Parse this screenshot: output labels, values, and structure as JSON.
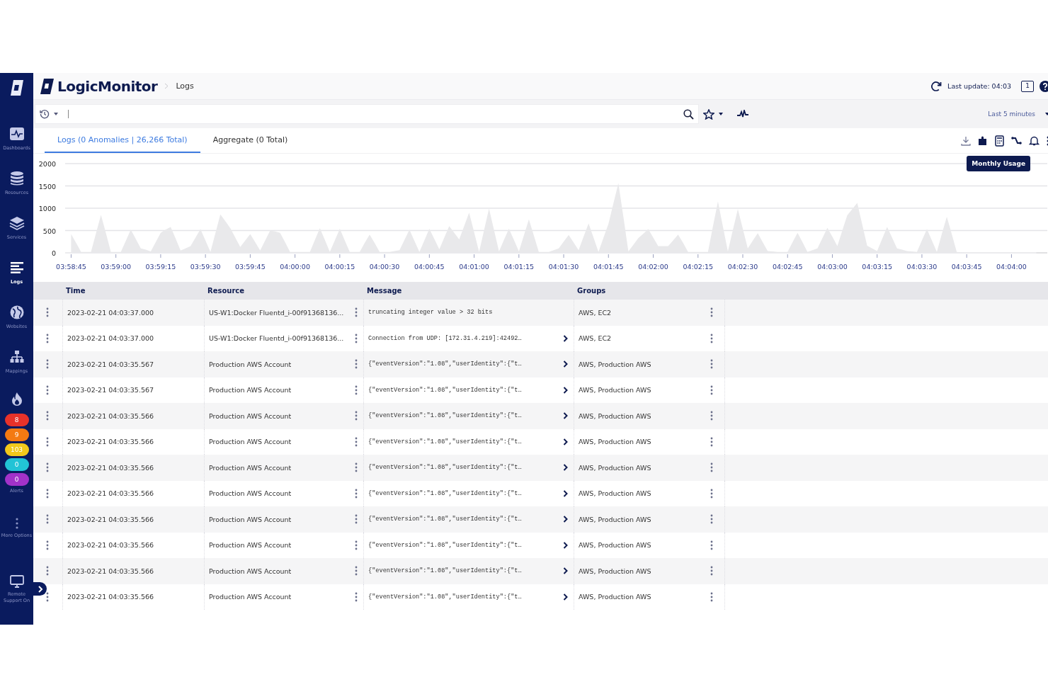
{
  "sidebar": {
    "nav": [
      {
        "label": "Dashboards",
        "selected": false
      },
      {
        "label": "Resources",
        "selected": false
      },
      {
        "label": "Services",
        "selected": false
      },
      {
        "label": "Logs",
        "selected": true
      },
      {
        "label": "Websites",
        "selected": false
      },
      {
        "label": "Mappings",
        "selected": false
      }
    ],
    "alert_badges": [
      {
        "count": "8",
        "color": "#e8322a"
      },
      {
        "count": "9",
        "color": "#f47a12"
      },
      {
        "count": "103",
        "color": "#f2c81b"
      },
      {
        "count": "0",
        "color": "#22c3d6"
      },
      {
        "count": "0",
        "color": "#a232c9"
      }
    ],
    "alerts_label": "Alerts",
    "more_options": "More Options",
    "remote_support": "Remote Support On"
  },
  "header": {
    "brand": "LogicMonitor",
    "breadcrumb": "Logs",
    "last_update": "Last update: 04:03",
    "notifications": "1"
  },
  "search": {
    "time_range": "Last 5 minutes"
  },
  "tabs": [
    {
      "label": "Logs (0 Anomalies | 26,266 Total)",
      "selected": true
    },
    {
      "label": "Aggregate (0 Total)",
      "selected": false
    }
  ],
  "tooltip": "Monthly Usage",
  "chart_data": {
    "type": "area",
    "grid": true,
    "ylim": [
      0,
      2000
    ],
    "yticks": [
      0,
      500,
      1000,
      1500,
      2000
    ],
    "categories": [
      "03:58:45",
      null,
      null,
      null,
      null,
      null,
      null,
      null,
      null,
      "03:59:00",
      null,
      null,
      null,
      null,
      null,
      null,
      null,
      null,
      "03:59:15",
      null,
      null,
      null,
      null,
      null,
      null,
      null,
      null,
      "03:59:30",
      null,
      null,
      null,
      null,
      null,
      null,
      null,
      null,
      "03:59:45",
      null,
      null,
      null,
      null,
      null,
      null,
      null,
      null,
      "04:00:00",
      null,
      null,
      null,
      null,
      null,
      null,
      null,
      null,
      "04:00:15",
      null,
      null,
      null,
      null,
      null,
      null,
      null,
      null,
      "04:00:30",
      null,
      null,
      null,
      null,
      null,
      null,
      null,
      null,
      "04:00:45",
      null,
      null,
      null,
      null,
      null,
      null,
      null,
      null,
      "04:01:00",
      null,
      null,
      null,
      null,
      null,
      null,
      null,
      null,
      "04:01:15",
      null,
      null,
      null,
      null,
      null,
      null,
      null,
      null,
      "04:01:30",
      null,
      null,
      null,
      null,
      null,
      null,
      null,
      null,
      "04:01:45",
      null,
      null,
      null,
      null,
      null,
      null,
      null,
      null,
      "04:02:00",
      null,
      null,
      null,
      null,
      null,
      null,
      null,
      null,
      "04:02:15",
      null,
      null,
      null,
      null,
      null,
      null,
      null,
      null,
      "04:02:30",
      null,
      null,
      null,
      null,
      null,
      null,
      null,
      null,
      "04:02:45",
      null,
      null,
      null,
      null,
      null,
      null,
      null,
      null,
      "04:03:00",
      null,
      null,
      null,
      null,
      null,
      null,
      null,
      null,
      "04:03:15",
      null,
      null,
      null,
      null,
      null,
      null,
      null,
      null,
      "04:03:30",
      null,
      null,
      null,
      null,
      null,
      null,
      null,
      null,
      "04:03:45",
      null,
      null,
      null,
      null,
      null,
      null,
      null,
      null,
      "04:04:00",
      null,
      null,
      null,
      null,
      null
    ],
    "values": [
      420,
      220,
      20,
      20,
      20,
      440,
      850,
      440,
      20,
      20,
      20,
      270,
      520,
      310,
      100,
      70,
      30,
      240,
      450,
      520,
      580,
      320,
      50,
      100,
      150,
      340,
      530,
      280,
      20,
      440,
      860,
      710,
      550,
      340,
      130,
      280,
      420,
      240,
      50,
      280,
      500,
      480,
      450,
      240,
      20,
      20,
      20,
      20,
      20,
      290,
      550,
      290,
      20,
      280,
      540,
      280,
      20,
      20,
      20,
      220,
      410,
      220,
      20,
      20,
      20,
      40,
      60,
      290,
      520,
      270,
      20,
      280,
      540,
      310,
      80,
      340,
      600,
      450,
      300,
      600,
      900,
      460,
      20,
      510,
      990,
      510,
      30,
      290,
      540,
      290,
      30,
      390,
      750,
      390,
      20,
      20,
      20,
      60,
      100,
      250,
      400,
      230,
      60,
      360,
      660,
      340,
      20,
      340,
      650,
      1110,
      1560,
      800,
      30,
      180,
      330,
      430,
      530,
      340,
      150,
      150,
      150,
      280,
      410,
      220,
      20,
      20,
      20,
      20,
      20,
      590,
      1150,
      590,
      30,
      510,
      980,
      540,
      100,
      270,
      440,
      240,
      40,
      30,
      20,
      20,
      20,
      240,
      450,
      240,
      20,
      60,
      100,
      330,
      560,
      360,
      150,
      500,
      840,
      980,
      1120,
      640,
      160,
      100,
      40,
      310,
      580,
      340,
      100,
      70,
      40,
      30,
      20,
      280,
      530,
      280,
      20,
      420,
      810,
      420,
      20,
      10,
      0,
      0,
      0,
      0,
      0,
      0,
      0,
      0,
      0,
      0,
      0,
      0,
      0,
      0,
      0
    ]
  },
  "table": {
    "columns": [
      "Time",
      "Resource",
      "Message",
      "Groups"
    ],
    "rows": [
      {
        "time": "2023-02-21 04:03:37.000",
        "resource": "US-W1:Docker Fluentd_i-00f91368136...",
        "message": "truncating integer value > 32 bits",
        "expandable": false,
        "groups": "AWS, EC2"
      },
      {
        "time": "2023-02-21 04:03:37.000",
        "resource": "US-W1:Docker Fluentd_i-00f91368136...",
        "message": "Connection from UDP: [172.31.4.219]:42492…",
        "expandable": true,
        "groups": "AWS, EC2"
      },
      {
        "time": "2023-02-21 04:03:35.567",
        "resource": "Production AWS Account",
        "message": "{\"eventVersion\":\"1.08\",\"userIdentity\":{\"t…",
        "expandable": true,
        "groups": "AWS, Production AWS"
      },
      {
        "time": "2023-02-21 04:03:35.567",
        "resource": "Production AWS Account",
        "message": "{\"eventVersion\":\"1.08\",\"userIdentity\":{\"t…",
        "expandable": true,
        "groups": "AWS, Production AWS"
      },
      {
        "time": "2023-02-21 04:03:35.566",
        "resource": "Production AWS Account",
        "message": "{\"eventVersion\":\"1.08\",\"userIdentity\":{\"t…",
        "expandable": true,
        "groups": "AWS, Production AWS"
      },
      {
        "time": "2023-02-21 04:03:35.566",
        "resource": "Production AWS Account",
        "message": "{\"eventVersion\":\"1.08\",\"userIdentity\":{\"t…",
        "expandable": true,
        "groups": "AWS, Production AWS"
      },
      {
        "time": "2023-02-21 04:03:35.566",
        "resource": "Production AWS Account",
        "message": "{\"eventVersion\":\"1.08\",\"userIdentity\":{\"t…",
        "expandable": true,
        "groups": "AWS, Production AWS"
      },
      {
        "time": "2023-02-21 04:03:35.566",
        "resource": "Production AWS Account",
        "message": "{\"eventVersion\":\"1.08\",\"userIdentity\":{\"t…",
        "expandable": true,
        "groups": "AWS, Production AWS"
      },
      {
        "time": "2023-02-21 04:03:35.566",
        "resource": "Production AWS Account",
        "message": "{\"eventVersion\":\"1.08\",\"userIdentity\":{\"t…",
        "expandable": true,
        "groups": "AWS, Production AWS"
      },
      {
        "time": "2023-02-21 04:03:35.566",
        "resource": "Production AWS Account",
        "message": "{\"eventVersion\":\"1.08\",\"userIdentity\":{\"t…",
        "expandable": true,
        "groups": "AWS, Production AWS"
      },
      {
        "time": "2023-02-21 04:03:35.566",
        "resource": "Production AWS Account",
        "message": "{\"eventVersion\":\"1.08\",\"userIdentity\":{\"t…",
        "expandable": true,
        "groups": "AWS, Production AWS"
      },
      {
        "time": "2023-02-21 04:03:35.566",
        "resource": "Production AWS Account",
        "message": "{\"eventVersion\":\"1.08\",\"userIdentity\":{\"t…",
        "expandable": true,
        "groups": "AWS, Production AWS"
      }
    ]
  }
}
